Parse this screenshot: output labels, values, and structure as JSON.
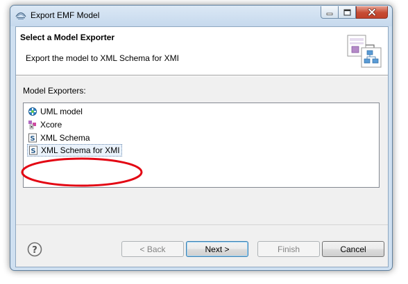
{
  "window": {
    "title": "Export EMF Model",
    "logo_icon": "emf-logo-icon",
    "controls": [
      "minimize-icon",
      "maximize-icon",
      "close-icon"
    ]
  },
  "header": {
    "title": "Select a Model Exporter",
    "description": "Export the model to XML Schema for XMI",
    "image_icon": "model-export-wizard-icon"
  },
  "exporters": {
    "label": "Model Exporters:",
    "items": [
      {
        "label": "UML model",
        "icon": "uml-model-icon"
      },
      {
        "label": "Xcore",
        "icon": "xcore-icon"
      },
      {
        "label": "XML Schema",
        "icon": "xml-schema-icon"
      },
      {
        "label": "XML Schema for XMI",
        "icon": "xml-schema-icon"
      }
    ],
    "selected": "XML Schema for XMI"
  },
  "buttons": {
    "back": "< Back",
    "next": "Next >",
    "finish": "Finish",
    "cancel": "Cancel",
    "help_icon": "help-icon"
  },
  "colors": {
    "annotation": "#e30613",
    "selection_bg": "#eaf2fb",
    "default_button_border": "#3c7fb1"
  }
}
